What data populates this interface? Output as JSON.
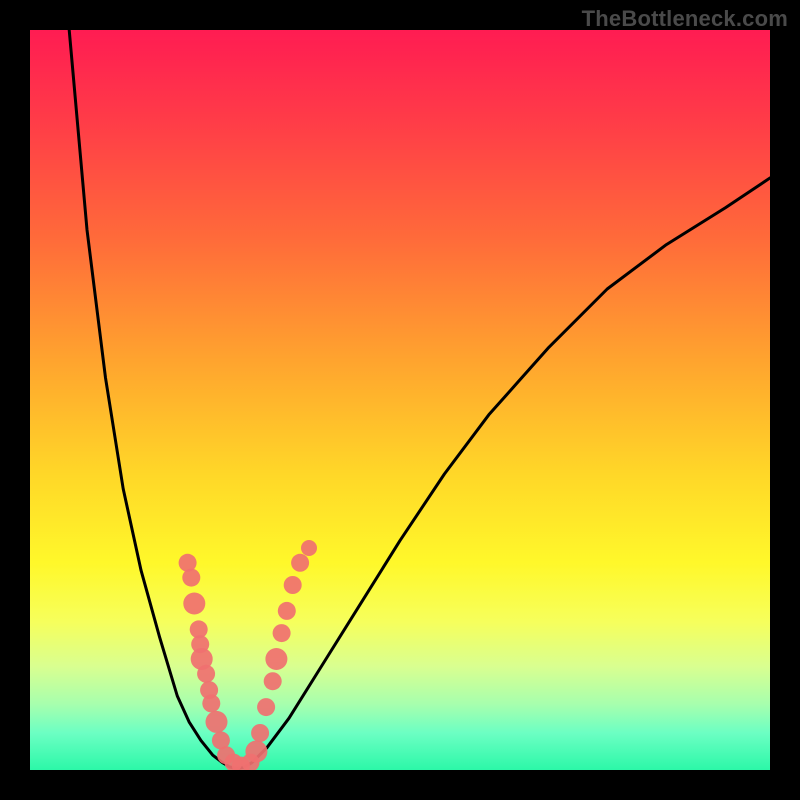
{
  "watermark": "TheBottleneck.com",
  "colors": {
    "frame": "#000000",
    "gradient_top": "#ff1c52",
    "gradient_bottom": "#2cf7a8",
    "curve": "#000000",
    "points": "#f07070"
  },
  "chart_data": {
    "type": "line",
    "title": "",
    "xlabel": "",
    "ylabel": "",
    "xlim": [
      0,
      1
    ],
    "ylim": [
      0,
      1
    ],
    "series": [
      {
        "name": "left-branch",
        "x": [
          0.053,
          0.077,
          0.102,
          0.126,
          0.15,
          0.175,
          0.199,
          0.215,
          0.231,
          0.247,
          0.26
        ],
        "y": [
          1.0,
          0.73,
          0.53,
          0.38,
          0.27,
          0.18,
          0.1,
          0.065,
          0.04,
          0.02,
          0.01
        ]
      },
      {
        "name": "valley-floor",
        "x": [
          0.26,
          0.27,
          0.28,
          0.29,
          0.3
        ],
        "y": [
          0.01,
          0.004,
          0.002,
          0.004,
          0.01
        ]
      },
      {
        "name": "right-branch",
        "x": [
          0.3,
          0.32,
          0.35,
          0.4,
          0.45,
          0.5,
          0.56,
          0.62,
          0.7,
          0.78,
          0.86,
          0.94,
          1.0
        ],
        "y": [
          0.01,
          0.03,
          0.07,
          0.15,
          0.23,
          0.31,
          0.4,
          0.48,
          0.57,
          0.65,
          0.71,
          0.76,
          0.8
        ]
      }
    ],
    "scatter_points": {
      "name": "highlight-dots",
      "points": [
        {
          "x": 0.213,
          "y": 0.28,
          "r": 9
        },
        {
          "x": 0.218,
          "y": 0.26,
          "r": 9
        },
        {
          "x": 0.222,
          "y": 0.225,
          "r": 11
        },
        {
          "x": 0.228,
          "y": 0.19,
          "r": 9
        },
        {
          "x": 0.23,
          "y": 0.17,
          "r": 9
        },
        {
          "x": 0.232,
          "y": 0.15,
          "r": 11
        },
        {
          "x": 0.238,
          "y": 0.13,
          "r": 9
        },
        {
          "x": 0.242,
          "y": 0.108,
          "r": 9
        },
        {
          "x": 0.245,
          "y": 0.09,
          "r": 9
        },
        {
          "x": 0.252,
          "y": 0.065,
          "r": 11
        },
        {
          "x": 0.258,
          "y": 0.04,
          "r": 9
        },
        {
          "x": 0.265,
          "y": 0.02,
          "r": 9
        },
        {
          "x": 0.275,
          "y": 0.01,
          "r": 9
        },
        {
          "x": 0.285,
          "y": 0.006,
          "r": 9
        },
        {
          "x": 0.298,
          "y": 0.01,
          "r": 9
        },
        {
          "x": 0.306,
          "y": 0.025,
          "r": 11
        },
        {
          "x": 0.311,
          "y": 0.05,
          "r": 9
        },
        {
          "x": 0.319,
          "y": 0.085,
          "r": 9
        },
        {
          "x": 0.328,
          "y": 0.12,
          "r": 9
        },
        {
          "x": 0.333,
          "y": 0.15,
          "r": 11
        },
        {
          "x": 0.34,
          "y": 0.185,
          "r": 9
        },
        {
          "x": 0.347,
          "y": 0.215,
          "r": 9
        },
        {
          "x": 0.355,
          "y": 0.25,
          "r": 9
        },
        {
          "x": 0.365,
          "y": 0.28,
          "r": 9
        },
        {
          "x": 0.377,
          "y": 0.3,
          "r": 8
        }
      ]
    }
  }
}
